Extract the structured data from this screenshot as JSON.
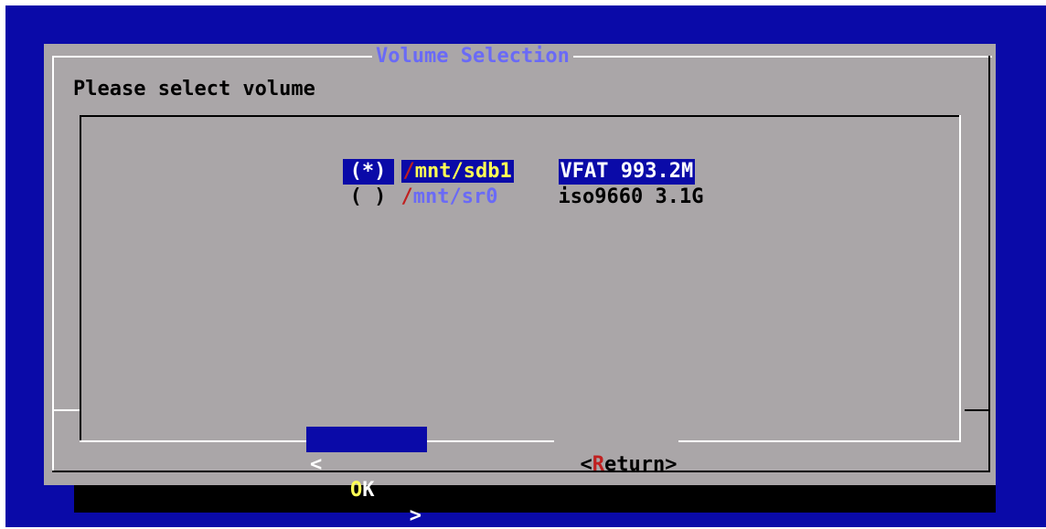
{
  "dialog": {
    "title": "Volume Selection",
    "prompt": "Please select volume"
  },
  "volumes": [
    {
      "radio": "(*)",
      "path_slash": "/",
      "path_rest": "mnt/sdb1",
      "info": "VFAT 993.2M",
      "selected": true
    },
    {
      "radio": "( )",
      "path_slash": "/",
      "path_rest": "mnt/sr0",
      "info": "iso9660 3.1G",
      "selected": false
    }
  ],
  "buttons": {
    "ok": {
      "left": "<",
      "hotkey": "O",
      "rest": "K",
      "right": ">"
    },
    "return": {
      "left": "<",
      "hotkey": "R",
      "rest": "eturn",
      "right": ">"
    }
  },
  "colors": {
    "background": "#0a0aa8",
    "dialog": "#aaa6a8",
    "title": "#6a6af6",
    "highlight": "#ffff55",
    "hotkey": "#c02020"
  }
}
